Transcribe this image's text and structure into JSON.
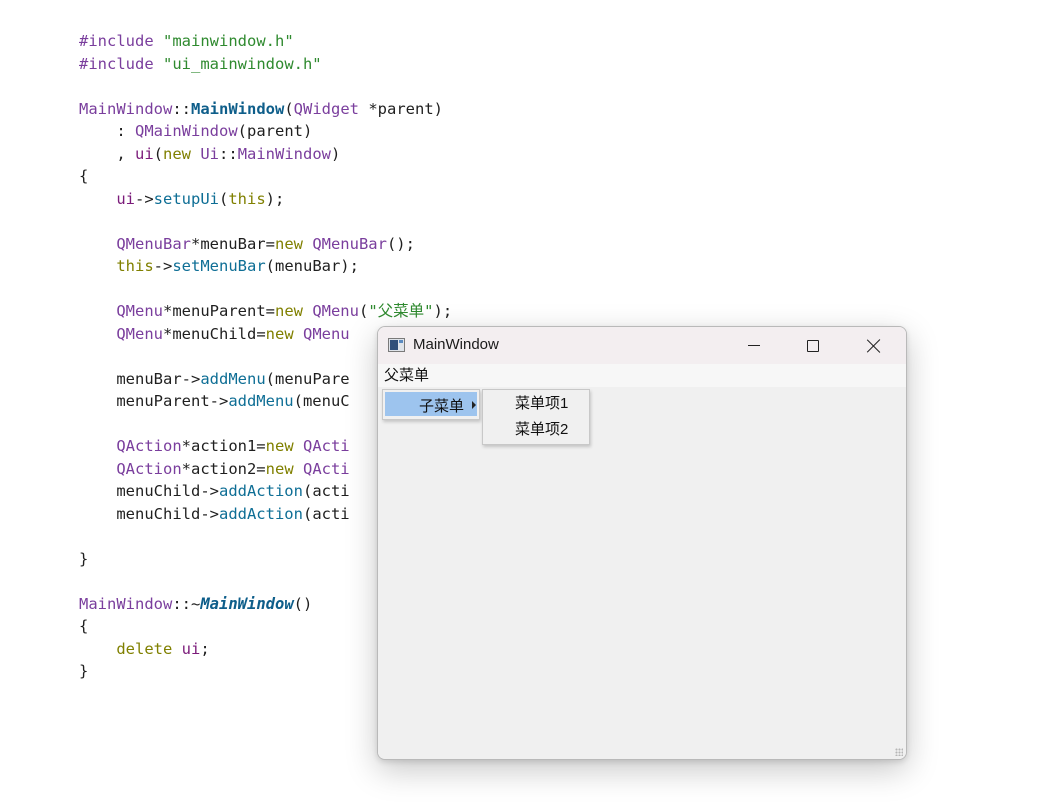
{
  "code_lines": [
    [
      {
        "t": "#include ",
        "c": "pp"
      },
      {
        "t": "\"mainwindow.h\"",
        "c": "str"
      }
    ],
    [
      {
        "t": "#include ",
        "c": "pp"
      },
      {
        "t": "\"ui_mainwindow.h\"",
        "c": "str"
      }
    ],
    [],
    [
      {
        "t": "MainWindow",
        "c": "cls"
      },
      {
        "t": "::",
        "c": "pl"
      },
      {
        "t": "MainWindow",
        "c": "fnb"
      },
      {
        "t": "(",
        "c": "pl"
      },
      {
        "t": "QWidget",
        "c": "cls"
      },
      {
        "t": " *parent)",
        "c": "pl"
      }
    ],
    [
      {
        "t": "    : ",
        "c": "pl"
      },
      {
        "t": "QMainWindow",
        "c": "cls"
      },
      {
        "t": "(parent)",
        "c": "pl"
      }
    ],
    [
      {
        "t": "    , ",
        "c": "pl"
      },
      {
        "t": "ui",
        "c": "var"
      },
      {
        "t": "(",
        "c": "pl"
      },
      {
        "t": "new ",
        "c": "kw"
      },
      {
        "t": "Ui",
        "c": "cls"
      },
      {
        "t": "::",
        "c": "pl"
      },
      {
        "t": "MainWindow",
        "c": "cls"
      },
      {
        "t": ")",
        "c": "pl"
      }
    ],
    [
      {
        "t": "{",
        "c": "pl"
      }
    ],
    [
      {
        "t": "    ",
        "c": "pl"
      },
      {
        "t": "ui",
        "c": "var"
      },
      {
        "t": "->",
        "c": "pl"
      },
      {
        "t": "setupUi",
        "c": "fn"
      },
      {
        "t": "(",
        "c": "pl"
      },
      {
        "t": "this",
        "c": "kw"
      },
      {
        "t": ");",
        "c": "pl"
      }
    ],
    [],
    [
      {
        "t": "    ",
        "c": "pl"
      },
      {
        "t": "QMenuBar",
        "c": "cls"
      },
      {
        "t": "*menuBar=",
        "c": "pl"
      },
      {
        "t": "new ",
        "c": "kw"
      },
      {
        "t": "QMenuBar",
        "c": "cls"
      },
      {
        "t": "();",
        "c": "pl"
      }
    ],
    [
      {
        "t": "    ",
        "c": "pl"
      },
      {
        "t": "this",
        "c": "kw"
      },
      {
        "t": "->",
        "c": "pl"
      },
      {
        "t": "setMenuBar",
        "c": "fn"
      },
      {
        "t": "(menuBar);",
        "c": "pl"
      }
    ],
    [],
    [
      {
        "t": "    ",
        "c": "pl"
      },
      {
        "t": "QMenu",
        "c": "cls"
      },
      {
        "t": "*menuParent=",
        "c": "pl"
      },
      {
        "t": "new ",
        "c": "kw"
      },
      {
        "t": "QMenu",
        "c": "cls"
      },
      {
        "t": "(",
        "c": "pl"
      },
      {
        "t": "\"父菜单\"",
        "c": "str"
      },
      {
        "t": ");",
        "c": "pl"
      }
    ],
    [
      {
        "t": "    ",
        "c": "pl"
      },
      {
        "t": "QMenu",
        "c": "cls"
      },
      {
        "t": "*menuChild=",
        "c": "pl"
      },
      {
        "t": "new ",
        "c": "kw"
      },
      {
        "t": "QMenu",
        "c": "cls"
      }
    ],
    [],
    [
      {
        "t": "    menuBar->",
        "c": "pl"
      },
      {
        "t": "addMenu",
        "c": "fn"
      },
      {
        "t": "(menuPare",
        "c": "pl"
      }
    ],
    [
      {
        "t": "    menuParent->",
        "c": "pl"
      },
      {
        "t": "addMenu",
        "c": "fn"
      },
      {
        "t": "(menuC",
        "c": "pl"
      }
    ],
    [],
    [
      {
        "t": "    ",
        "c": "pl"
      },
      {
        "t": "QAction",
        "c": "cls"
      },
      {
        "t": "*action1=",
        "c": "pl"
      },
      {
        "t": "new ",
        "c": "kw"
      },
      {
        "t": "QActi",
        "c": "cls"
      }
    ],
    [
      {
        "t": "    ",
        "c": "pl"
      },
      {
        "t": "QAction",
        "c": "cls"
      },
      {
        "t": "*action2=",
        "c": "pl"
      },
      {
        "t": "new ",
        "c": "kw"
      },
      {
        "t": "QActi",
        "c": "cls"
      }
    ],
    [
      {
        "t": "    menuChild->",
        "c": "pl"
      },
      {
        "t": "addAction",
        "c": "fn"
      },
      {
        "t": "(acti",
        "c": "pl"
      }
    ],
    [
      {
        "t": "    menuChild->",
        "c": "pl"
      },
      {
        "t": "addAction",
        "c": "fn"
      },
      {
        "t": "(acti",
        "c": "pl"
      }
    ],
    [],
    [
      {
        "t": "}",
        "c": "pl"
      }
    ],
    [],
    [
      {
        "t": "MainWindow",
        "c": "cls"
      },
      {
        "t": "::~",
        "c": "pl"
      },
      {
        "t": "MainWindow",
        "c": "fnbi"
      },
      {
        "t": "()",
        "c": "pl"
      }
    ],
    [
      {
        "t": "{",
        "c": "pl"
      }
    ],
    [
      {
        "t": "    ",
        "c": "pl"
      },
      {
        "t": "delete ",
        "c": "kw"
      },
      {
        "t": "ui",
        "c": "var"
      },
      {
        "t": ";",
        "c": "pl"
      }
    ],
    [
      {
        "t": "}",
        "c": "pl"
      }
    ]
  ],
  "window": {
    "title": "MainWindow",
    "icon": "qt-app-window-icon",
    "controls": {
      "minimize": "minimize-icon",
      "maximize": "maximize-icon",
      "close": "close-icon"
    },
    "menubar": {
      "items": [
        "父菜单"
      ]
    },
    "parent_menu": {
      "items": [
        {
          "label": "子菜单",
          "has_submenu": true,
          "highlighted": true
        }
      ]
    },
    "child_menu": {
      "items": [
        "菜单项1",
        "菜单项2"
      ]
    }
  },
  "colors": {
    "preprocessor": "#7a3e9d",
    "string": "#2f8a2f",
    "class": "#7a3e9d",
    "function": "#0e6e95",
    "keyword": "#808000",
    "member": "#7b1b7a",
    "menu_highlight": "#9dc4ee",
    "window_bg": "#f0f0f0"
  }
}
